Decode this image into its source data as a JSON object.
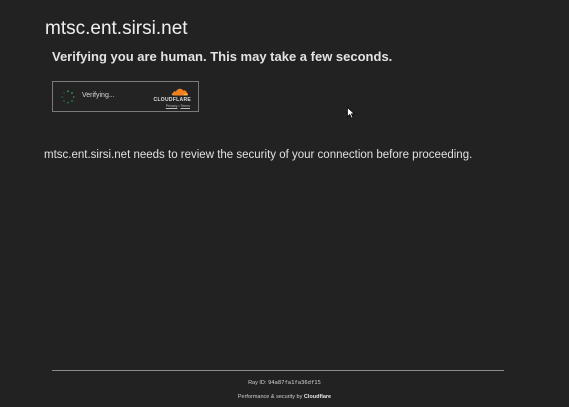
{
  "page": {
    "domain_title": "mtsc.ent.sirsi.net",
    "verify_heading": "Verifying you are human. This may take a few seconds.",
    "security_message": "mtsc.ent.sirsi.net needs to review the security of your connection before proceeding."
  },
  "widget": {
    "status_text": "Verifying...",
    "brand_wordmark": "CLOUDFLARE",
    "privacy_link": "Privacy",
    "separator": "•",
    "terms_link": "Terms",
    "spinner_icon": "loading-spinner-icon",
    "logo_icon": "cloudflare-cloud-icon"
  },
  "footer": {
    "ray_label": "Ray ID:",
    "ray_value": "94a87fa1fa36df15",
    "perf_prefix": "Performance & security by",
    "perf_brand": "Cloudflare"
  },
  "colors": {
    "background": "#222222",
    "cloudflare_orange": "#f38020",
    "spinner_green": "#3aa55d"
  }
}
